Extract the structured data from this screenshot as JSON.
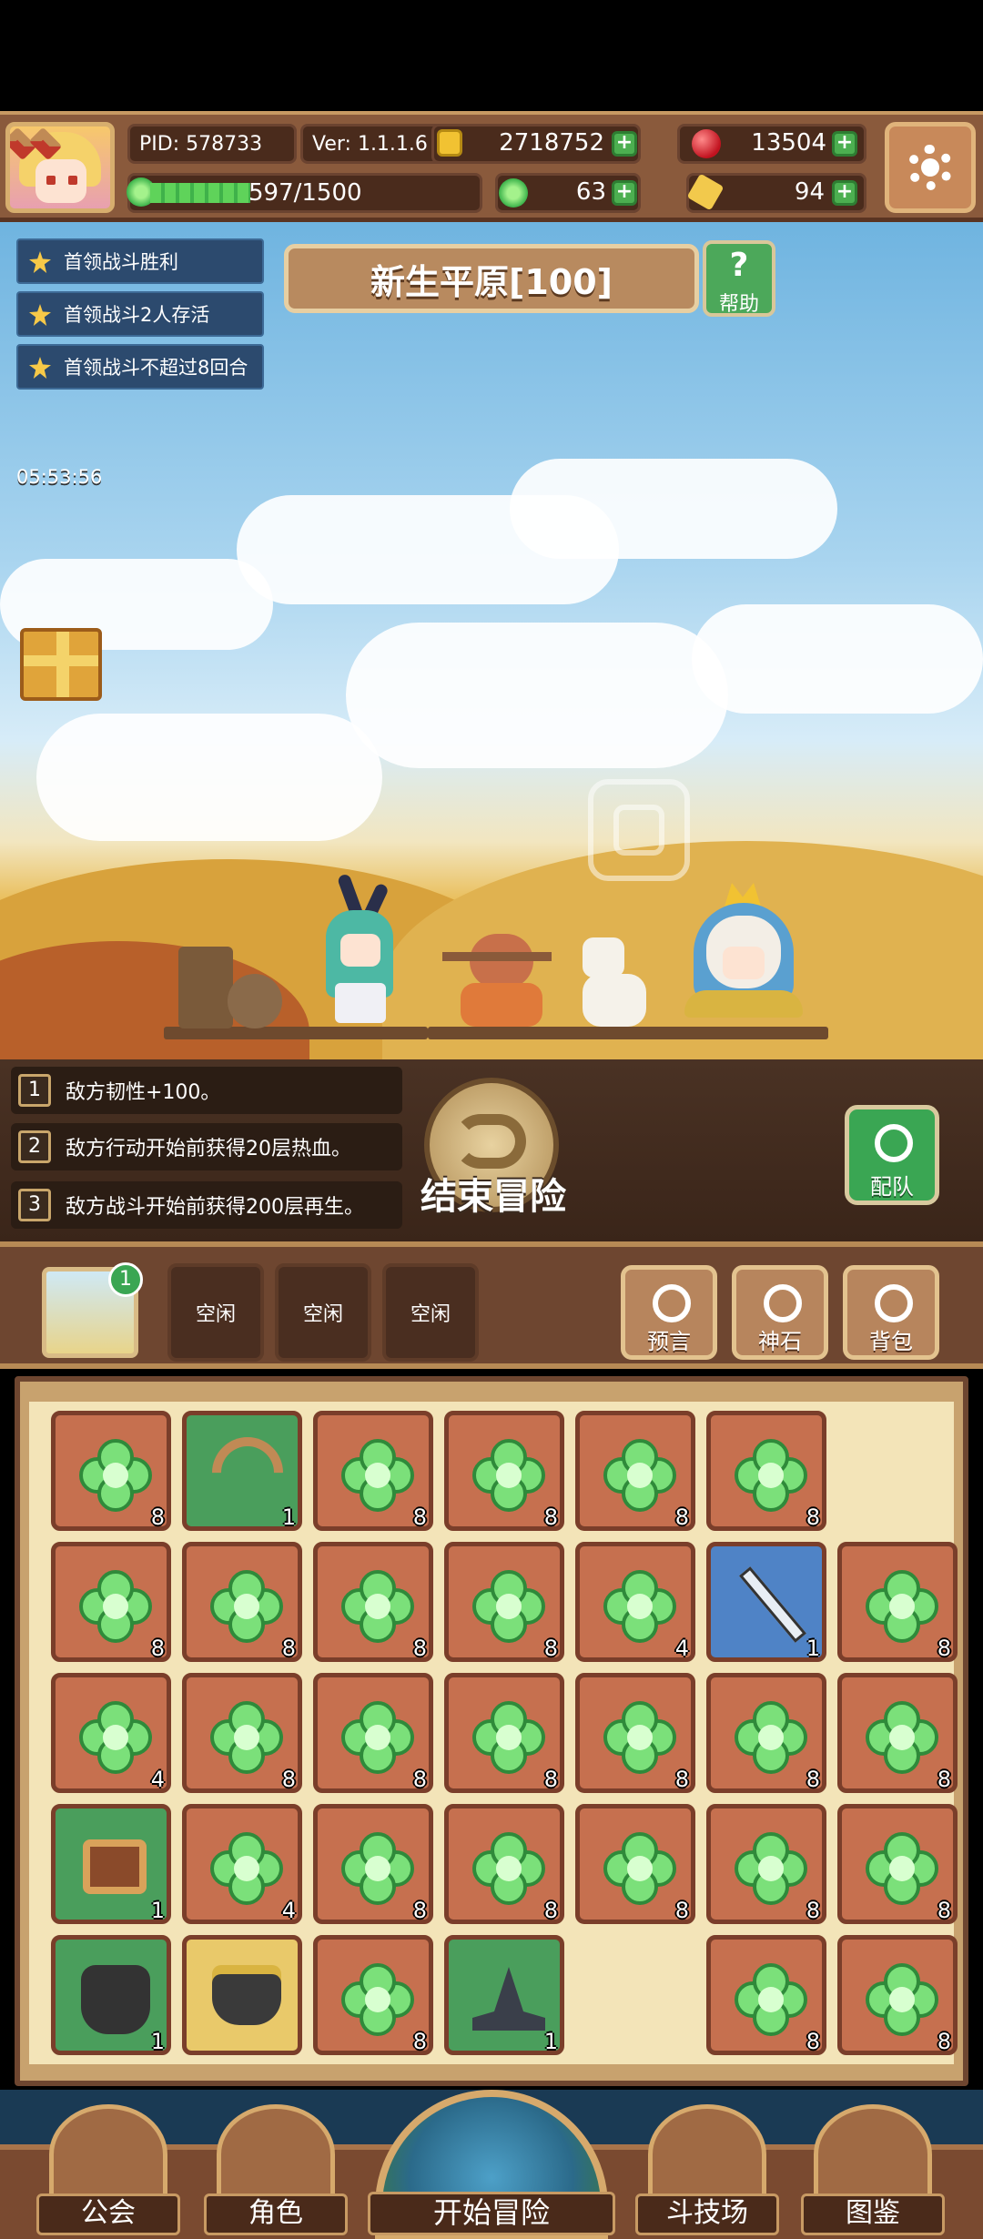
{
  "header": {
    "pid": "PID: 578733",
    "version": "Ver: 1.1.1.6",
    "gold": "2718752",
    "gems": "13504",
    "energy": "597/1500",
    "clover_count": "63",
    "key_count": "94"
  },
  "quests": [
    "首领战斗胜利",
    "首领战斗2人存活",
    "首领战斗不超过8回合"
  ],
  "area": {
    "title": "新生平原[100]",
    "help_label": "帮助"
  },
  "gift_timer": "05:53:56",
  "battle_rules": [
    {
      "num": "1",
      "text": "敌方韧性+100。"
    },
    {
      "num": "2",
      "text": "敌方行动开始前获得20层热血。"
    },
    {
      "num": "3",
      "text": "敌方战斗开始前获得200层再生。"
    }
  ],
  "end_adventure_label": "结束冒险",
  "team_label": "配队",
  "map_slot_badge": "1",
  "idle_slots": [
    "空闲",
    "空闲",
    "空闲"
  ],
  "menu_buttons": [
    "预言",
    "神石",
    "背包"
  ],
  "inventory": {
    "rows": [
      [
        {
          "item": "clover",
          "count": "8"
        },
        {
          "item": "bow",
          "count": "1"
        },
        {
          "item": "clover",
          "count": "8"
        },
        {
          "item": "clover",
          "count": "8"
        },
        {
          "item": "clover",
          "count": "8"
        },
        {
          "item": "clover",
          "count": "8"
        },
        {
          "item": "empty",
          "count": ""
        }
      ],
      [
        {
          "item": "clover",
          "count": "8"
        },
        {
          "item": "clover",
          "count": "8"
        },
        {
          "item": "clover",
          "count": "8"
        },
        {
          "item": "clover",
          "count": "8"
        },
        {
          "item": "clover",
          "count": "4"
        },
        {
          "item": "sword",
          "count": "1"
        },
        {
          "item": "clover",
          "count": "8"
        }
      ],
      [
        {
          "item": "clover",
          "count": "4"
        },
        {
          "item": "clover",
          "count": "8"
        },
        {
          "item": "clover",
          "count": "8"
        },
        {
          "item": "clover",
          "count": "8"
        },
        {
          "item": "clover",
          "count": "8"
        },
        {
          "item": "clover",
          "count": "8"
        },
        {
          "item": "clover",
          "count": "8"
        }
      ],
      [
        {
          "item": "bag",
          "count": "1"
        },
        {
          "item": "clover",
          "count": "4"
        },
        {
          "item": "clover",
          "count": "8"
        },
        {
          "item": "clover",
          "count": "8"
        },
        {
          "item": "clover",
          "count": "8"
        },
        {
          "item": "clover",
          "count": "8"
        },
        {
          "item": "clover",
          "count": "8"
        }
      ],
      [
        {
          "item": "armor",
          "count": "1"
        },
        {
          "item": "pot",
          "count": ""
        },
        {
          "item": "clover",
          "count": "8"
        },
        {
          "item": "hat",
          "count": "1"
        },
        {
          "item": "empty",
          "count": ""
        },
        {
          "item": "clover",
          "count": "8"
        },
        {
          "item": "clover",
          "count": "8"
        }
      ]
    ]
  },
  "nav": [
    "公会",
    "角色",
    "开始冒险",
    "斗技场",
    "图鉴"
  ]
}
